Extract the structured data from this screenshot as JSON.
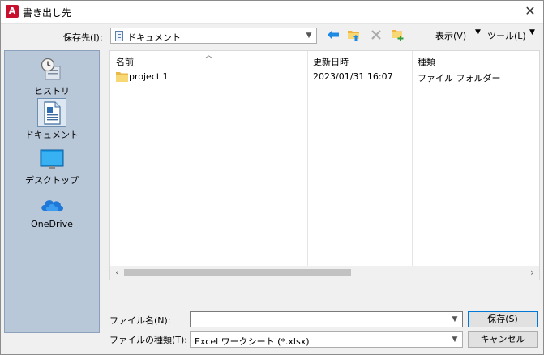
{
  "window": {
    "title": "書き出し先",
    "app_icon_letter": "A"
  },
  "toolbar": {
    "save_in_label": "保存先(I):",
    "location_value": "ドキュメント",
    "view_menu": "表示(V)",
    "tools_menu": "ツール(L)"
  },
  "places": [
    {
      "label": "ヒストリ",
      "icon": "history-icon"
    },
    {
      "label": "ドキュメント",
      "icon": "documents-icon"
    },
    {
      "label": "デスクトップ",
      "icon": "desktop-icon"
    },
    {
      "label": "OneDrive",
      "icon": "onedrive-icon"
    }
  ],
  "filelist": {
    "columns": [
      "名前",
      "更新日時",
      "種類"
    ],
    "rows": [
      {
        "name": "project 1",
        "date": "2023/01/31 16:07",
        "type": "ファイル フォルダー"
      }
    ]
  },
  "footer": {
    "filename_label": "ファイル名(N):",
    "filename_value": "",
    "filetype_label": "ファイルの種類(T):",
    "filetype_value": "Excel ワークシート (*.xlsx)",
    "save_button": "保存(S)",
    "cancel_button": "キャンセル"
  },
  "colors": {
    "places_bg": "#b9c8d9",
    "folder_yellow": "#f8d775",
    "back_arrow": "#1e88e5",
    "app_icon_red": "#c8102e"
  }
}
